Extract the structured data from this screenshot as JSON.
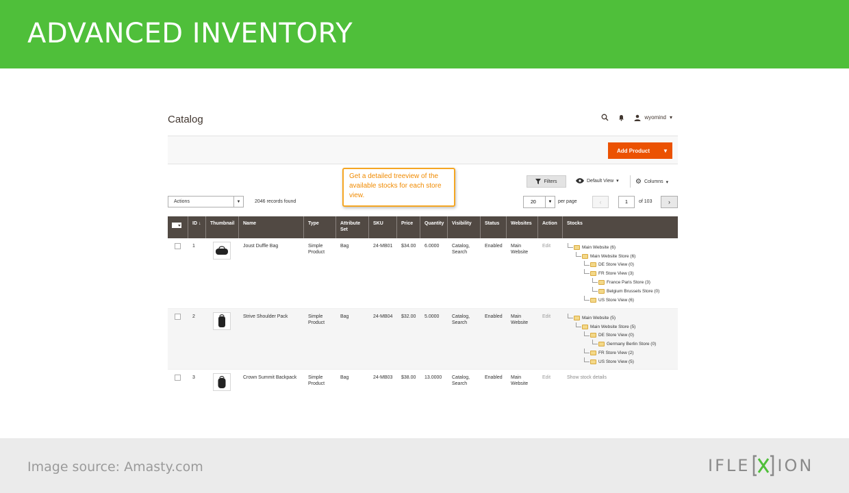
{
  "banner": {
    "title": "ADVANCED INVENTORY"
  },
  "footer": {
    "source": "Image source: Amasty.com",
    "logo_left": "IFLE",
    "logo_right": "ION"
  },
  "screenshot": {
    "page_title": "Catalog",
    "user": "wyomind",
    "add_product": "Add Product",
    "callout": "Get a detailed treeview of the available stocks for each store view.",
    "filters": "Filters",
    "default_view": "Default View",
    "columns": "Columns",
    "actions": "Actions",
    "records": "2046 records found",
    "per_page_value": "20",
    "per_page_label": "per page",
    "page_current": "1",
    "page_of": "of 103",
    "headers": [
      "ID",
      "Thumbnail",
      "Name",
      "Type",
      "Attribute Set",
      "SKU",
      "Price",
      "Quantity",
      "Visibility",
      "Status",
      "Websites",
      "Action",
      "Stocks"
    ],
    "rows": [
      {
        "id": "1",
        "name": "Joust Duffle Bag",
        "type": "Simple Product",
        "attribute_set": "Bag",
        "sku": "24-MB01",
        "price": "$34.00",
        "quantity": "6.0000",
        "visibility": "Catalog, Search",
        "status": "Enabled",
        "websites": "Main Website",
        "action": "Edit",
        "tree": [
          {
            "label": "Main Website (6)",
            "level": 0
          },
          {
            "label": "Main Website Store (6)",
            "level": 1
          },
          {
            "label": "DE Store View (0)",
            "level": 2
          },
          {
            "label": "FR Store View (3)",
            "level": 2
          },
          {
            "label": "France Paris Store (3)",
            "level": 3
          },
          {
            "label": "Belgium Brussels Store (0)",
            "level": 3
          },
          {
            "label": "US Store View (6)",
            "level": 2
          }
        ]
      },
      {
        "id": "2",
        "name": "Strive Shoulder Pack",
        "type": "Simple Product",
        "attribute_set": "Bag",
        "sku": "24-MB04",
        "price": "$32.00",
        "quantity": "5.0000",
        "visibility": "Catalog, Search",
        "status": "Enabled",
        "websites": "Main Website",
        "action": "Edit",
        "tree": [
          {
            "label": "Main Website (5)",
            "level": 0
          },
          {
            "label": "Main Website Store (5)",
            "level": 1
          },
          {
            "label": "DE Store View (0)",
            "level": 2
          },
          {
            "label": "Germany Berlin Store (0)",
            "level": 3
          },
          {
            "label": "FR Store View (2)",
            "level": 2
          },
          {
            "label": "US Store View (5)",
            "level": 2
          }
        ]
      },
      {
        "id": "3",
        "name": "Crown Summit Backpack",
        "type": "Simple Product",
        "attribute_set": "Bag",
        "sku": "24-MB03",
        "price": "$38.00",
        "quantity": "13.0000",
        "visibility": "Catalog, Search",
        "status": "Enabled",
        "websites": "Main Website",
        "action": "Edit",
        "stock_link": "Show stock details"
      }
    ]
  }
}
